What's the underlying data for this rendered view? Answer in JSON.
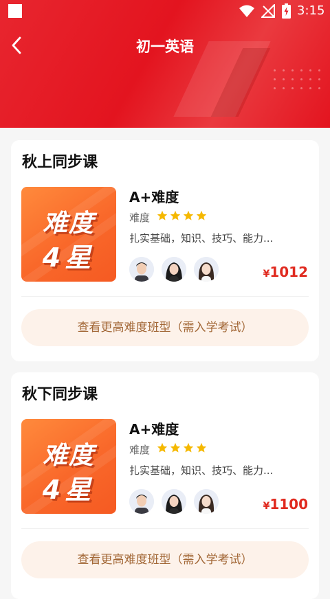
{
  "status_bar": {
    "time": "3:15"
  },
  "header": {
    "title": "初一英语"
  },
  "sections": [
    {
      "title": "秋上同步课",
      "course": {
        "thumb_line1": "难度",
        "thumb_line2": "4星",
        "name": "A+难度",
        "difficulty_label": "难度",
        "stars": 4,
        "description": "扎实基础，知识、技巧、能力...",
        "price_symbol": "¥",
        "price": "1012"
      },
      "more_button": "查看更高难度班型（需入学考试）"
    },
    {
      "title": "秋下同步课",
      "course": {
        "thumb_line1": "难度",
        "thumb_line2": "4星",
        "name": "A+难度",
        "difficulty_label": "难度",
        "stars": 4,
        "description": "扎实基础，知识、技巧、能力...",
        "price_symbol": "¥",
        "price": "1100"
      },
      "more_button": "查看更高难度班型（需入学考试）"
    }
  ],
  "colors": {
    "brand_red": "#e3141f",
    "price_red": "#e02a1f",
    "star": "#f5b800",
    "button_text": "#a26736"
  }
}
